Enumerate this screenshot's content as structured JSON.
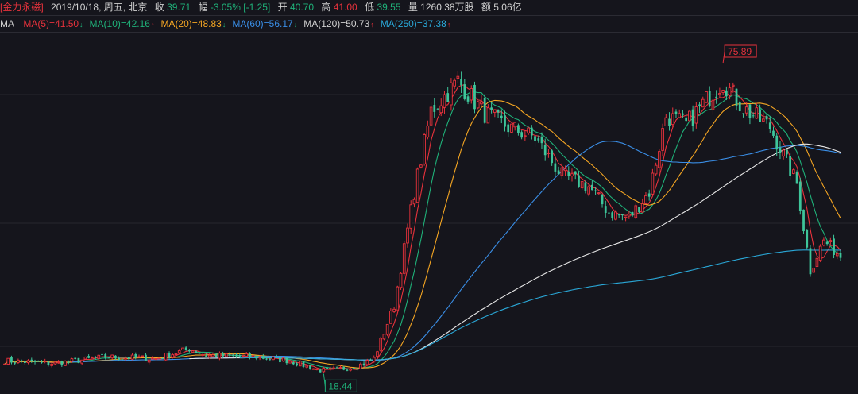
{
  "info": {
    "name": "[金力永磁]",
    "date": "2019/10/18, 周五, 北京",
    "close_label": "收",
    "close_value": "39.71",
    "change_label": "幅",
    "change_value": "-3.05%",
    "change_abs": "[-1.25]",
    "open_label": "开",
    "open_value": "40.70",
    "high_label": "高",
    "high_value": "41.00",
    "low_label": "低",
    "low_value": "39.55",
    "volume_label": "量",
    "volume_value": "1260.38万股",
    "amount_label": "额",
    "amount_value": "5.06亿"
  },
  "ma": {
    "label": "MA",
    "items": [
      {
        "text": "MA(5)=41.50",
        "color": "#e8323c",
        "arrow": "↓"
      },
      {
        "text": "MA(10)=42.16",
        "color": "#1fb179",
        "arrow": "↑"
      },
      {
        "text": "MA(20)=48.83",
        "color": "#f5a623",
        "arrow": "↓"
      },
      {
        "text": "MA(60)=56.17",
        "color": "#3a8ee6",
        "arrow": "↓"
      },
      {
        "text": "MA(120)=50.73",
        "color": "#d0d0d0",
        "arrow": "↑"
      },
      {
        "text": "MA(250)=37.38",
        "color": "#2aa8d8",
        "arrow": "↑"
      }
    ]
  },
  "chart_data": {
    "type": "candlestick",
    "ylim": [
      16,
      80
    ],
    "annotations": [
      {
        "text": "75.89",
        "price": 75.89,
        "kind": "max",
        "index": 214
      },
      {
        "text": "18.44",
        "price": 18.44,
        "kind": "min",
        "index": 95
      }
    ],
    "ma_colors": [
      "#e8323c",
      "#1fb179",
      "#f5a623",
      "#3a8ee6",
      "#e6e6e6",
      "#2aa8d8"
    ],
    "up_color": "#e8323c",
    "down_color": "#3ec59a"
  }
}
